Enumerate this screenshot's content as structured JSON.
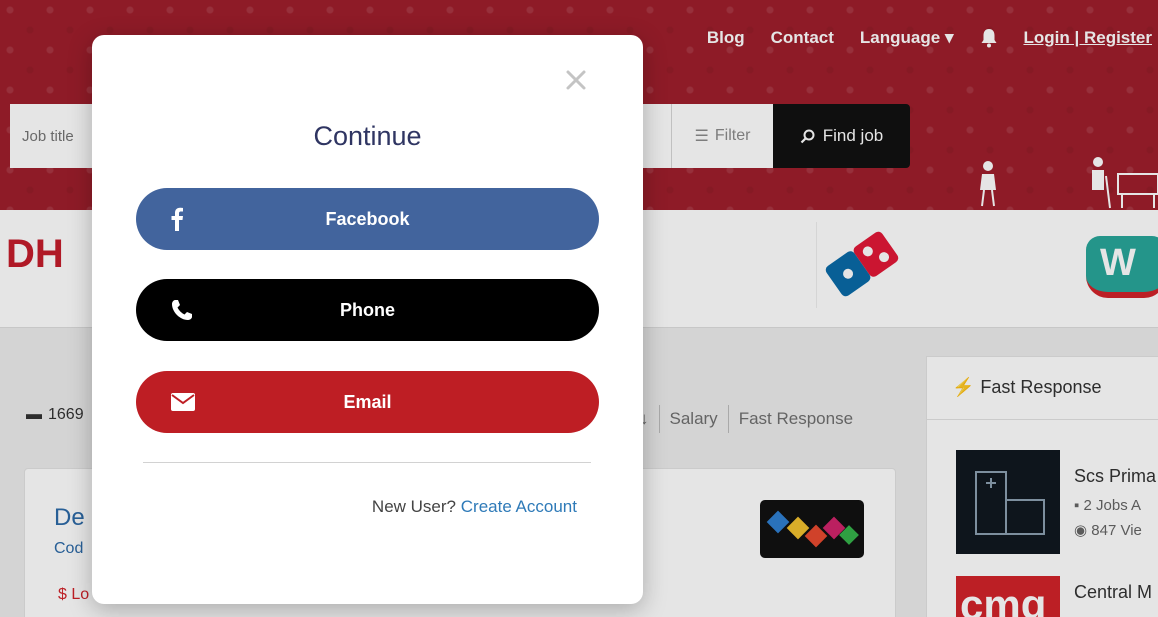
{
  "nav": {
    "blog": "Blog",
    "contact": "Contact",
    "language": "Language",
    "login_register": "Login | Register"
  },
  "search": {
    "placeholder": "Job title",
    "filter_label": "Filter",
    "find_job_label": "Find job"
  },
  "logos": {
    "dh_text": "DH",
    "w_text": "W"
  },
  "content": {
    "job_count": "1669",
    "sort_salary": "Salary",
    "sort_fast": "Fast Response",
    "job_title": "De",
    "job_company": "Cod",
    "job_salary": "$ Lo"
  },
  "fast_response": {
    "header": "Fast Response",
    "employers": [
      {
        "name": "Scs Prima",
        "jobs": "2 Jobs A",
        "views": "847 Vie"
      },
      {
        "name": "Central M",
        "logo_text": "cmg"
      }
    ]
  },
  "modal": {
    "title": "Continue",
    "facebook_label": "Facebook",
    "phone_label": "Phone",
    "email_label": "Email",
    "new_user_text": "New User?",
    "create_account_label": "Create Account"
  },
  "colors": {
    "brand_red": "#9f1f2c",
    "facebook_blue": "#42649d",
    "email_red": "#be1e24",
    "link_blue": "#2e7ab8",
    "title_navy": "#2f3562"
  }
}
